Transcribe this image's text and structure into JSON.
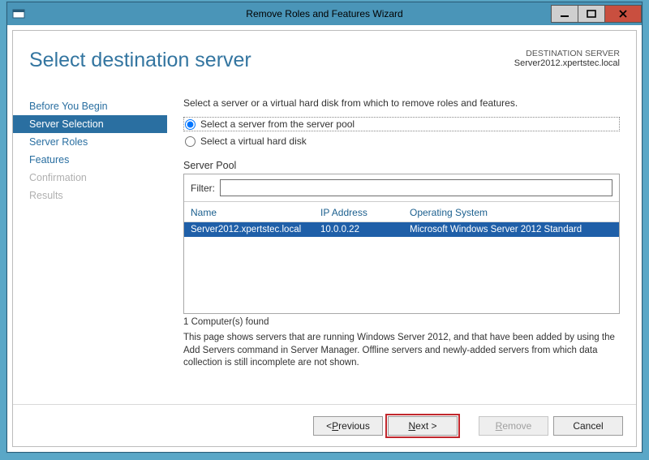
{
  "window": {
    "title": "Remove Roles and Features Wizard"
  },
  "header": {
    "title": "Select destination server",
    "dest_label": "DESTINATION SERVER",
    "dest_server": "Server2012.xpertstec.local"
  },
  "nav": {
    "items": [
      {
        "label": "Before You Begin",
        "state": "normal"
      },
      {
        "label": "Server Selection",
        "state": "active"
      },
      {
        "label": "Server Roles",
        "state": "normal"
      },
      {
        "label": "Features",
        "state": "normal"
      },
      {
        "label": "Confirmation",
        "state": "disabled"
      },
      {
        "label": "Results",
        "state": "disabled"
      }
    ]
  },
  "content": {
    "instruction": "Select a server or a virtual hard disk from which to remove roles and features.",
    "radio_pool": "Select a server from the server pool",
    "radio_vhd": "Select a virtual hard disk",
    "pool_label": "Server Pool",
    "filter_label": "Filter:",
    "filter_value": "",
    "columns": {
      "name": "Name",
      "ip": "IP Address",
      "os": "Operating System"
    },
    "rows": [
      {
        "name": "Server2012.xpertstec.local",
        "ip": "10.0.0.22",
        "os": "Microsoft Windows Server 2012 Standard"
      }
    ],
    "found_text": "1 Computer(s) found",
    "help_text": "This page shows servers that are running Windows Server 2012, and that have been added by using the Add Servers command in Server Manager. Offline servers and newly-added servers from which data collection is still incomplete are not shown."
  },
  "footer": {
    "previous_pre": "< ",
    "previous_ul": "P",
    "previous_post": "revious",
    "next_ul": "N",
    "next_post": "ext >",
    "remove_ul": "R",
    "remove_post": "emove",
    "cancel": "Cancel"
  }
}
